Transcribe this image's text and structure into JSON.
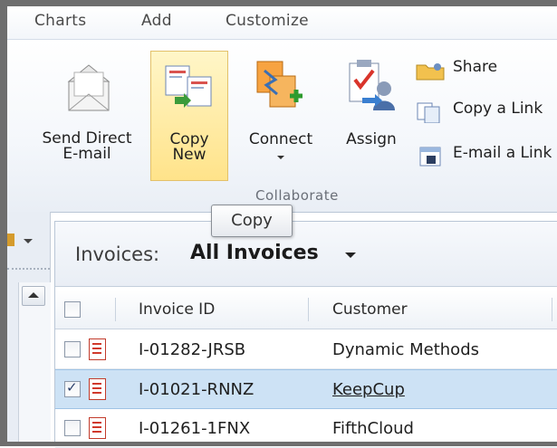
{
  "ribbon_tabs": [
    "Charts",
    "Add",
    "Customize"
  ],
  "ribbon": {
    "send_direct_email": [
      "Send Direct",
      "E-mail"
    ],
    "copy_new": [
      "Copy",
      "New"
    ],
    "connect": "Connect",
    "assign": "Assign",
    "share": "Share",
    "copy_link": "Copy a Link",
    "email_link": "E-mail a Link",
    "group_label": "Collaborate"
  },
  "tooltip": "Copy",
  "view": {
    "label": "Invoices:",
    "name": "All Invoices"
  },
  "grid": {
    "columns": [
      "Invoice ID",
      "Customer"
    ],
    "rows": [
      {
        "invoice_id": "I-01282-JRSB",
        "customer": "Dynamic Methods",
        "checked": false,
        "selected": false
      },
      {
        "invoice_id": "I-01021-RNNZ",
        "customer": "KeepCup",
        "checked": true,
        "selected": true
      },
      {
        "invoice_id": "I-01261-1FNX",
        "customer": "FifthCloud",
        "checked": false,
        "selected": false
      }
    ]
  }
}
